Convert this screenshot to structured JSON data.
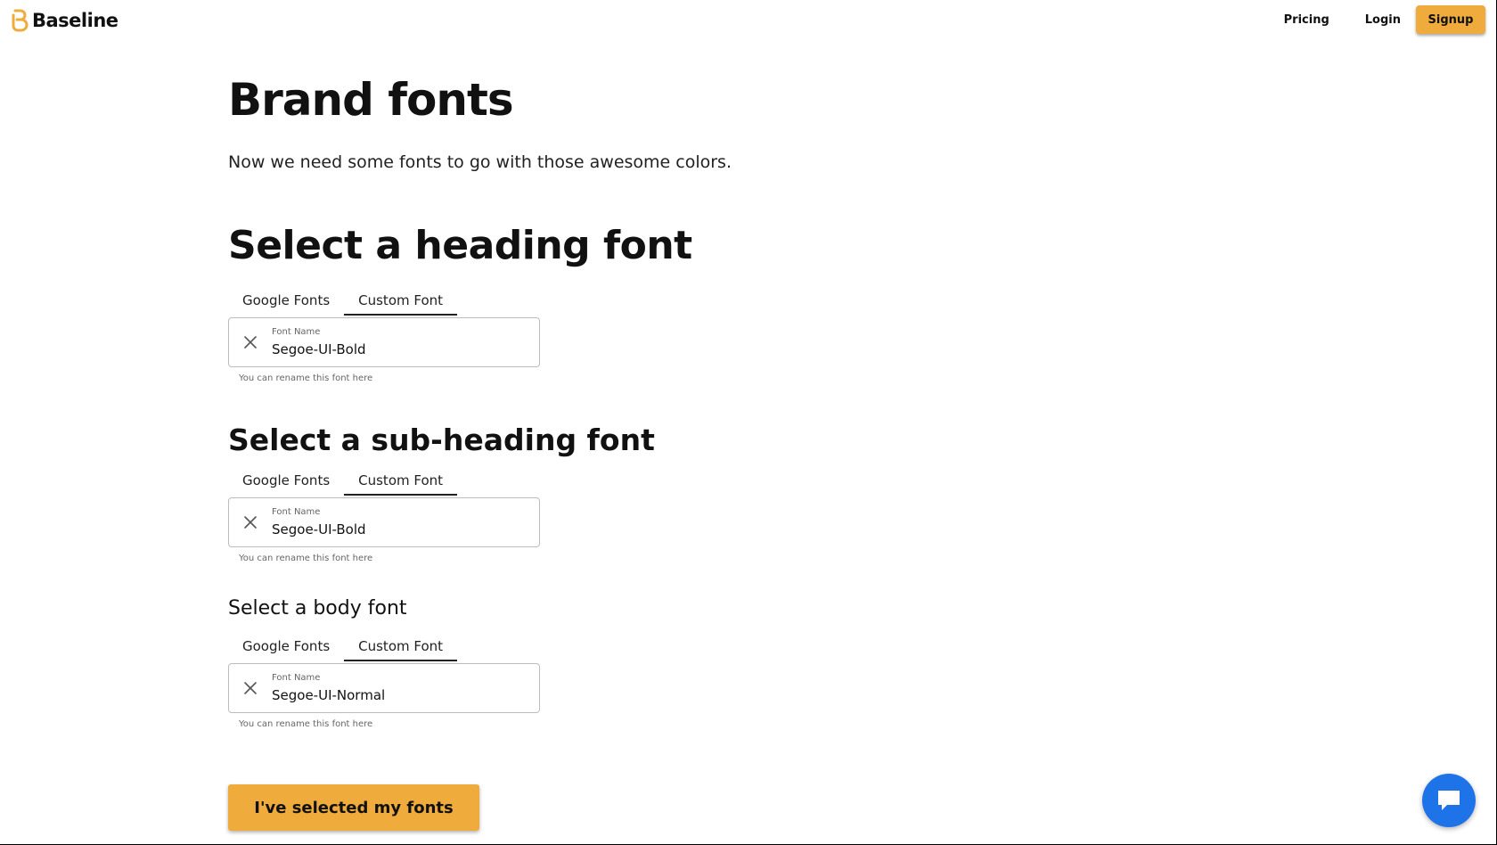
{
  "nav": {
    "brand": "Baseline",
    "links": {
      "pricing": "Pricing",
      "login": "Login",
      "signup": "Signup"
    }
  },
  "page": {
    "title": "Brand fonts",
    "subtitle": "Now we need some fonts to go with those awesome colors."
  },
  "sections": [
    {
      "heading": "Select a heading font",
      "tabs": [
        "Google Fonts",
        "Custom Font"
      ],
      "active_tab": "Custom Font",
      "field_label": "Font Name",
      "field_value": "Segoe-UI-Bold",
      "helper": "You can rename this font here"
    },
    {
      "heading": "Select a sub-heading font",
      "tabs": [
        "Google Fonts",
        "Custom Font"
      ],
      "active_tab": "Custom Font",
      "field_label": "Font Name",
      "field_value": "Segoe-UI-Bold",
      "helper": "You can rename this font here"
    },
    {
      "heading": "Select a body font",
      "tabs": [
        "Google Fonts",
        "Custom Font"
      ],
      "active_tab": "Custom Font",
      "field_label": "Font Name",
      "field_value": "Segoe-UI-Normal",
      "helper": "You can rename this font here"
    }
  ],
  "submit_label": "I've selected my fonts",
  "icons": {
    "logo": "baseline-logo-icon",
    "clear": "close-icon",
    "chat": "chat-bubble-icon"
  },
  "colors": {
    "accent": "#efac3d",
    "chat": "#1f73e8",
    "text": "#111111"
  }
}
